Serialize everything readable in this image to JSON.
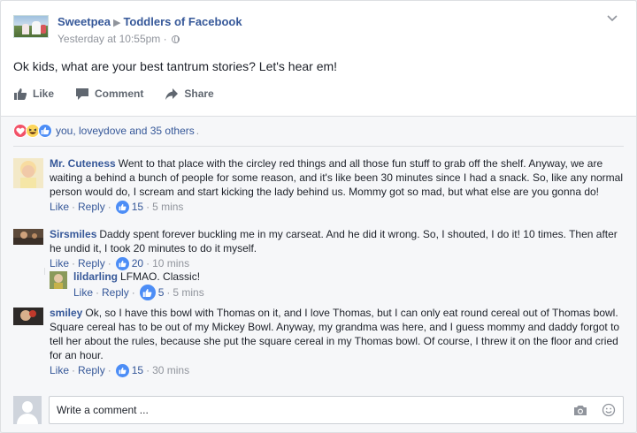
{
  "post": {
    "author": "Sweetpea",
    "group": "Toddlers of Facebook",
    "timestamp": "Yesterday at 10:55pm",
    "privacy_icon": "globe-icon",
    "text": "Ok kids, what are your best tantrum stories? Let's hear em!"
  },
  "actions": {
    "like": "Like",
    "comment": "Comment",
    "share": "Share"
  },
  "reactions": {
    "icons": [
      "love-icon",
      "haha-icon",
      "like-icon"
    ],
    "summary": "you, loveydove and 35 others",
    "dot": "."
  },
  "comments": [
    {
      "author": "Mr. Cuteness",
      "text": "Went to that place with the circley red things and all those fun stuff to grab off the shelf. Anyway, we are waiting a behind a bunch of people for some reason, and it's like been 30 minutes since I had a snack. So, like any normal person would do, I scream and start kicking the lady behind us. Mommy got so mad, but what else are you gonna do!",
      "like": "Like",
      "reply": "Reply",
      "likes": "15",
      "time": "5 mins"
    },
    {
      "author": "Sirsmiles",
      "text": "Daddy spent forever buckling me in my carseat. And he did it wrong. So, I shouted, I do it! 10 times. Then after he undid it, I took 20 minutes to do it myself.",
      "like": "Like",
      "reply": "Reply",
      "likes": "20",
      "time": "10 mins"
    },
    {
      "author": "smiley",
      "text": "Ok, so I have this bowl with Thomas on it, and I love Thomas, but I can only eat round cereal out of Thomas bowl. Square cereal has to be out of my Mickey Bowl. Anyway, my grandma was here, and I guess mommy and daddy forgot to tell her about the rules, because she put the square cereal in my Thomas bowl. Of course, I threw it on the floor and cried for an hour.",
      "like": "Like",
      "reply": "Reply",
      "likes": "15",
      "time": "30 mins"
    }
  ],
  "reply": {
    "author": "lildarling",
    "text": "LFMAO. Classic!",
    "like": "Like",
    "reply": "Reply",
    "likes": "5",
    "time": "5 mins"
  },
  "composer": {
    "placeholder": "Write a comment ...",
    "camera_icon": "camera-icon",
    "emoji_icon": "emoji-icon"
  },
  "colors": {
    "link": "#365899",
    "muted": "#90949c",
    "like_blue": "#4c8df6",
    "love_red": "#f25268",
    "haha_yellow": "#fcd55a"
  }
}
